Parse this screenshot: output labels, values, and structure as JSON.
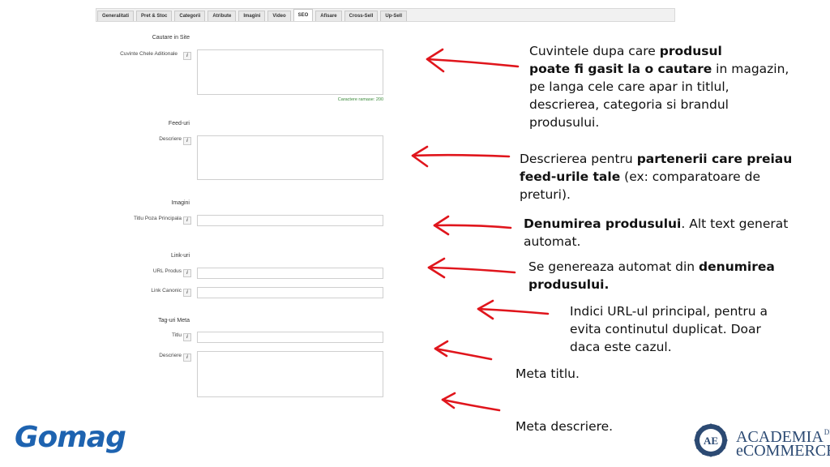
{
  "tabs": [
    "Generalitati",
    "Pret & Stoc",
    "Categorii",
    "Atribute",
    "Imagini",
    "Video",
    "SEO",
    "Afisare",
    "Cross-Sell",
    "Up-Sell"
  ],
  "active_tab": "SEO",
  "form": {
    "section_search": "Cautare in Site",
    "label_keywords": "Cuvinte Chele Aditionale",
    "counter": "Caractere ramase: 200",
    "section_feeds": "Feed-uri",
    "label_feed_desc": "Descriere",
    "section_images": "Imagini",
    "label_main_image_title": "Titlu Poza Principala",
    "section_links": "Link-uri",
    "label_url": "URL Produs",
    "label_canonical": "Link Canonic",
    "section_meta": "Tag-uri Meta",
    "label_meta_title": "Titlu",
    "label_meta_desc": "Descriere",
    "info_glyph": "i"
  },
  "annotations": {
    "a1": {
      "t1": "Cuvintele dupa care ",
      "b1": "produsul",
      "b2": "poate fi gasit la o cautare",
      "t2": " in magazin,",
      "t3": "pe langa cele care apar in titlul,",
      "t4": "descrierea, categoria si brandul",
      "t5": "produsului."
    },
    "a2": {
      "t1": "Descrierea pentru ",
      "b1": "partenerii care preiau",
      "b2": "feed-urile tale",
      "t2": " (ex: comparatoare de",
      "t3": "preturi)."
    },
    "a3": {
      "b1": "Denumirea produsului",
      "t1": ". Alt text generat",
      "t2": "automat."
    },
    "a4": {
      "t1": "Se genereaza automat din ",
      "b1": "denumirea",
      "b2": "produsului."
    },
    "a5": {
      "t1": "Indici URL-ul principal, pentru a",
      "t2": "evita continutul duplicat. Doar",
      "t3": "daca este cazul."
    },
    "a6": "Meta titlu.",
    "a7": "Meta descriere."
  },
  "logos": {
    "gomag": "Gomag",
    "academia_line1": "ACADEMIA",
    "academia_de": "DE",
    "academia_line2": "eCOMMERCE",
    "emblem": "AE"
  },
  "colors": {
    "arrow": "#e0151c",
    "brand_blue": "#1e63b0",
    "counter_green": "#3a8a3a"
  }
}
